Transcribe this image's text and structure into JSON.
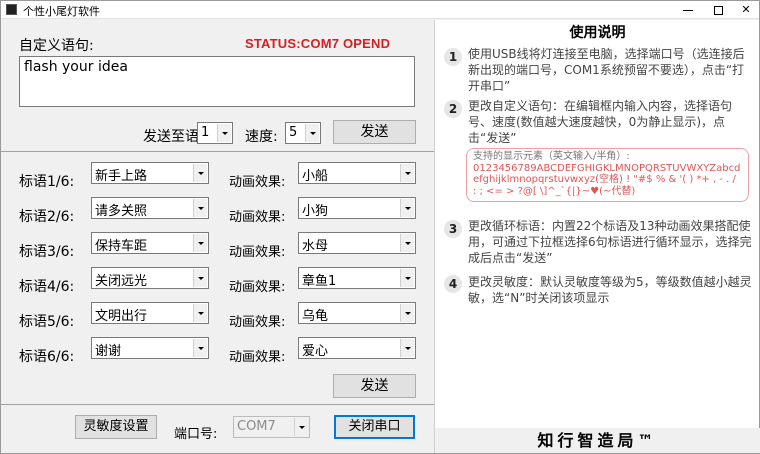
{
  "window": {
    "title": "个性小尾灯软件",
    "min_label": "",
    "max_label": "",
    "close_label": "✕"
  },
  "custom": {
    "label": "自定义语句:",
    "status": "STATUS:COM7 OPEND",
    "text": "flash your idea",
    "send_to_label": "发送至语句:",
    "slot_value": "1",
    "speed_label": "速度:",
    "speed_value": "5",
    "send_button": "发送"
  },
  "slogans": {
    "effect_label": "动画效果:",
    "rows": [
      {
        "label": "标语1/6:",
        "slogan": "新手上路",
        "effect": "小船"
      },
      {
        "label": "标语2/6:",
        "slogan": "请多关照",
        "effect": "小狗"
      },
      {
        "label": "标语3/6:",
        "slogan": "保持车距",
        "effect": "水母"
      },
      {
        "label": "标语4/6:",
        "slogan": "关闭远光",
        "effect": "章鱼1"
      },
      {
        "label": "标语5/6:",
        "slogan": "文明出行",
        "effect": "乌龟"
      },
      {
        "label": "标语6/6:",
        "slogan": "谢谢",
        "effect": "爱心"
      }
    ],
    "send_button": "发送"
  },
  "footer": {
    "sensitivity_button": "灵敏度设置",
    "port_label": "端口号:",
    "port_value": "COM7",
    "close_port_button": "关闭串口"
  },
  "help": {
    "title": "使用说明",
    "steps": [
      {
        "num": "1",
        "text": "使用USB线将灯连接至电脑，选择端口号（选连接后新出现的端口号，COM1系统预留不要选），点击“打开串口”"
      },
      {
        "num": "2",
        "text": "更改自定义语句：在编辑框内输入内容，选择语句号、速度(数值越大速度越快，0为静止显示)，点击“发送”"
      },
      {
        "num": "3",
        "text": "更改循环标语：内置22个标语及13种动画效果搭配使用，可通过下拉框选择6句标语进行循环显示，选择完成后点击“发送”"
      },
      {
        "num": "4",
        "text": "更改灵敏度：默认灵敏度等级为5，等级数值越小越灵敏，选“N”时关闭该项显示"
      }
    ],
    "charset_title": "支持的显示元素（英文输入/半角）:",
    "charset_chars": "0123456789ABCDEFGHIGKLMNOPQRSTUVWXYZabcdefghijklmnopqrstuvwxyz(空格) ! \"#$ % & '( ) *+ , - . / : ; <= > ?@[ \\]^_`{|}~♥(~代替)",
    "brand": "知行智造局™"
  },
  "colors": {
    "status_red": "#d42020",
    "focus_blue": "#0078d7",
    "charset_red": "#e25555"
  }
}
